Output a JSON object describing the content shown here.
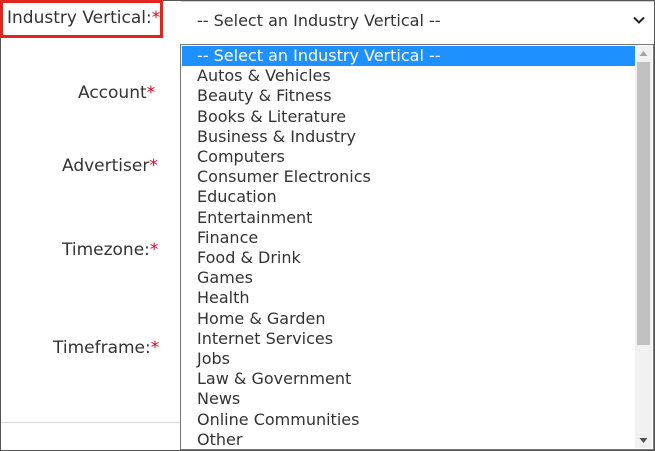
{
  "form": {
    "industry_label": "Industry Vertical:",
    "account_label": "Account",
    "advertiser_label": "Advertiser",
    "timezone_label": "Timezone:",
    "timeframe_label": "Timeframe:",
    "required_mark": "*"
  },
  "select": {
    "value": "-- Select an Industry Vertical --"
  },
  "dropdown": {
    "options": [
      "-- Select an Industry Vertical --",
      "Autos & Vehicles",
      "Beauty & Fitness",
      "Books & Literature",
      "Business & Industry",
      "Computers",
      "Consumer Electronics",
      "Education",
      "Entertainment",
      "Finance",
      "Food & Drink",
      "Games",
      "Health",
      "Home & Garden",
      "Internet Services",
      "Jobs",
      "Law & Government",
      "News",
      "Online Communities",
      "Other"
    ],
    "selected_index": 0
  },
  "colors": {
    "highlight_border": "#e0261f",
    "required": "#e0001b",
    "selected_option": "#1e90ff"
  }
}
